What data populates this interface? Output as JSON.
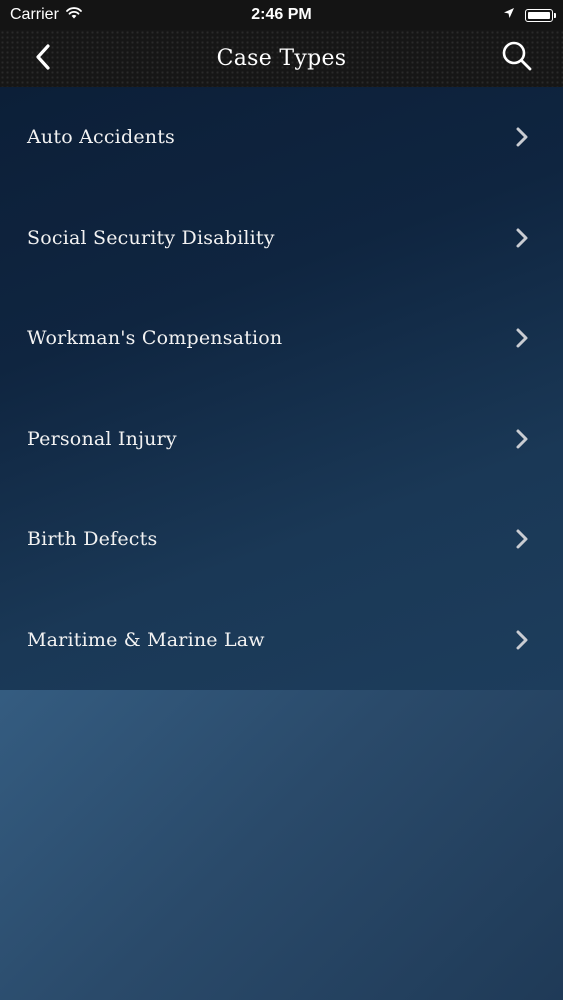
{
  "status_bar": {
    "carrier": "Carrier",
    "time": "2:46 PM"
  },
  "nav": {
    "title": "Case Types",
    "back_icon": "chevron-left-icon",
    "search_icon": "search-icon"
  },
  "case_types": [
    {
      "label": "Auto Accidents"
    },
    {
      "label": "Social Security Disability"
    },
    {
      "label": "Workman's Compensation"
    },
    {
      "label": "Personal Injury"
    },
    {
      "label": "Birth Defects"
    },
    {
      "label": "Maritime & Marine Law"
    }
  ],
  "colors": {
    "navbar": "#161616",
    "list_bg": "#0f2540",
    "page_bg": "#3f6b90",
    "chevron": "#c9ccd2"
  }
}
